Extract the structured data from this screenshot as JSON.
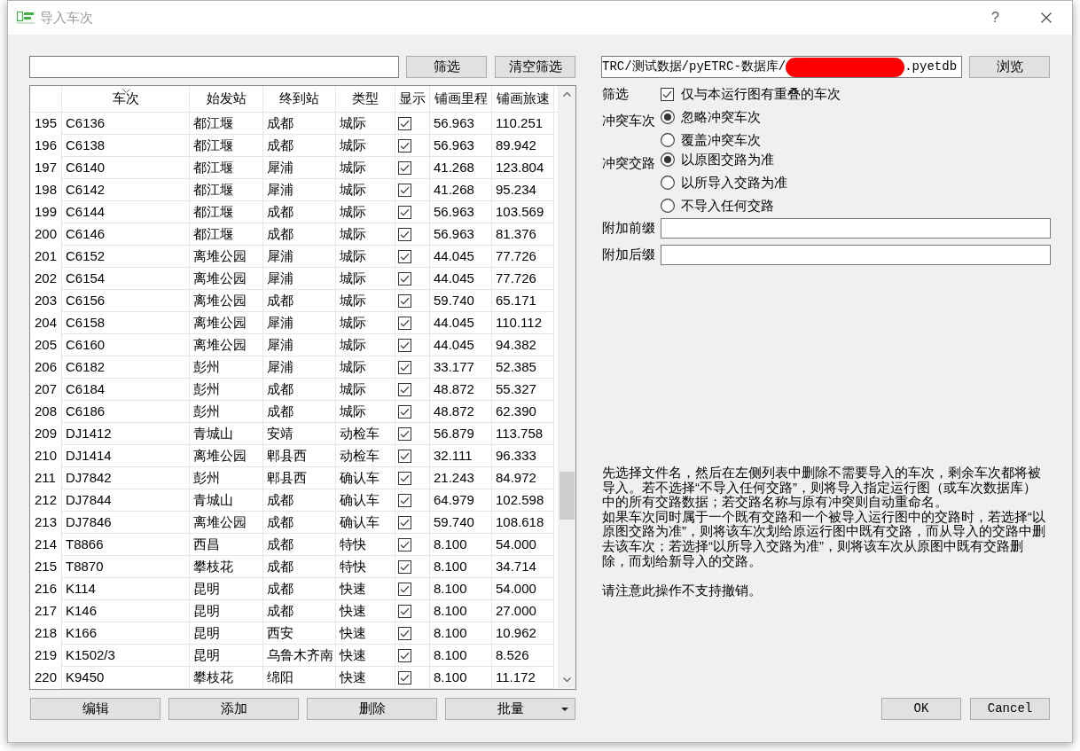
{
  "window": {
    "title": "导入车次",
    "help": "?"
  },
  "filter_bar": {
    "buttons": [
      "筛选",
      "清空筛选"
    ]
  },
  "table": {
    "columns": [
      {
        "label": "车次",
        "kind": "text",
        "sorted": true
      },
      {
        "label": "始发站",
        "kind": "text",
        "sorted": false
      },
      {
        "label": "终到站",
        "kind": "text",
        "sorted": false
      },
      {
        "label": "类型",
        "kind": "text",
        "sorted": false
      },
      {
        "label": "显示",
        "kind": "check",
        "sorted": false
      },
      {
        "label": "铺画里程",
        "kind": "text",
        "sorted": false
      },
      {
        "label": "铺画旅速",
        "kind": "text",
        "sorted": false
      }
    ],
    "rows": [
      {
        "index": "195",
        "train": "C6136",
        "origin": "都江堰",
        "terminal": "成都",
        "type": "城际",
        "shown": true,
        "mileage": "56.963",
        "speed": "110.251"
      },
      {
        "index": "196",
        "train": "C6138",
        "origin": "都江堰",
        "terminal": "成都",
        "type": "城际",
        "shown": true,
        "mileage": "56.963",
        "speed": "89.942"
      },
      {
        "index": "197",
        "train": "C6140",
        "origin": "都江堰",
        "terminal": "犀浦",
        "type": "城际",
        "shown": true,
        "mileage": "41.268",
        "speed": "123.804"
      },
      {
        "index": "198",
        "train": "C6142",
        "origin": "都江堰",
        "terminal": "犀浦",
        "type": "城际",
        "shown": true,
        "mileage": "41.268",
        "speed": "95.234"
      },
      {
        "index": "199",
        "train": "C6144",
        "origin": "都江堰",
        "terminal": "成都",
        "type": "城际",
        "shown": true,
        "mileage": "56.963",
        "speed": "103.569"
      },
      {
        "index": "200",
        "train": "C6146",
        "origin": "都江堰",
        "terminal": "成都",
        "type": "城际",
        "shown": true,
        "mileage": "56.963",
        "speed": "81.376"
      },
      {
        "index": "201",
        "train": "C6152",
        "origin": "离堆公园",
        "terminal": "犀浦",
        "type": "城际",
        "shown": true,
        "mileage": "44.045",
        "speed": "77.726"
      },
      {
        "index": "202",
        "train": "C6154",
        "origin": "离堆公园",
        "terminal": "犀浦",
        "type": "城际",
        "shown": true,
        "mileage": "44.045",
        "speed": "77.726"
      },
      {
        "index": "203",
        "train": "C6156",
        "origin": "离堆公园",
        "terminal": "成都",
        "type": "城际",
        "shown": true,
        "mileage": "59.740",
        "speed": "65.171"
      },
      {
        "index": "204",
        "train": "C6158",
        "origin": "离堆公园",
        "terminal": "犀浦",
        "type": "城际",
        "shown": true,
        "mileage": "44.045",
        "speed": "110.112"
      },
      {
        "index": "205",
        "train": "C6160",
        "origin": "离堆公园",
        "terminal": "犀浦",
        "type": "城际",
        "shown": true,
        "mileage": "44.045",
        "speed": "94.382"
      },
      {
        "index": "206",
        "train": "C6182",
        "origin": "彭州",
        "terminal": "犀浦",
        "type": "城际",
        "shown": true,
        "mileage": "33.177",
        "speed": "52.385"
      },
      {
        "index": "207",
        "train": "C6184",
        "origin": "彭州",
        "terminal": "成都",
        "type": "城际",
        "shown": true,
        "mileage": "48.872",
        "speed": "55.327"
      },
      {
        "index": "208",
        "train": "C6186",
        "origin": "彭州",
        "terminal": "成都",
        "type": "城际",
        "shown": true,
        "mileage": "48.872",
        "speed": "62.390"
      },
      {
        "index": "209",
        "train": "DJ1412",
        "origin": "青城山",
        "terminal": "安靖",
        "type": "动检车",
        "shown": true,
        "mileage": "56.879",
        "speed": "113.758"
      },
      {
        "index": "210",
        "train": "DJ1414",
        "origin": "离堆公园",
        "terminal": "郫县西",
        "type": "动检车",
        "shown": true,
        "mileage": "32.111",
        "speed": "96.333"
      },
      {
        "index": "211",
        "train": "DJ7842",
        "origin": "彭州",
        "terminal": "郫县西",
        "type": "确认车",
        "shown": true,
        "mileage": "21.243",
        "speed": "84.972"
      },
      {
        "index": "212",
        "train": "DJ7844",
        "origin": "青城山",
        "terminal": "成都",
        "type": "确认车",
        "shown": true,
        "mileage": "64.979",
        "speed": "102.598"
      },
      {
        "index": "213",
        "train": "DJ7846",
        "origin": "离堆公园",
        "terminal": "成都",
        "type": "确认车",
        "shown": true,
        "mileage": "59.740",
        "speed": "108.618"
      },
      {
        "index": "214",
        "train": "T8866",
        "origin": "西昌",
        "terminal": "成都",
        "type": "特快",
        "shown": true,
        "mileage": "8.100",
        "speed": "54.000"
      },
      {
        "index": "215",
        "train": "T8870",
        "origin": "攀枝花",
        "terminal": "成都",
        "type": "特快",
        "shown": true,
        "mileage": "8.100",
        "speed": "34.714"
      },
      {
        "index": "216",
        "train": "K114",
        "origin": "昆明",
        "terminal": "成都",
        "type": "快速",
        "shown": true,
        "mileage": "8.100",
        "speed": "54.000"
      },
      {
        "index": "217",
        "train": "K146",
        "origin": "昆明",
        "terminal": "成都",
        "type": "快速",
        "shown": true,
        "mileage": "8.100",
        "speed": "27.000"
      },
      {
        "index": "218",
        "train": "K166",
        "origin": "昆明",
        "terminal": "西安",
        "type": "快速",
        "shown": true,
        "mileage": "8.100",
        "speed": "10.962"
      },
      {
        "index": "219",
        "train": "K1502/3",
        "origin": "昆明",
        "terminal": "乌鲁木齐南",
        "type": "快速",
        "shown": true,
        "mileage": "8.100",
        "speed": "8.526"
      },
      {
        "index": "220",
        "train": "K9450",
        "origin": "攀枝花",
        "terminal": "绵阳",
        "type": "快速",
        "shown": true,
        "mileage": "8.100",
        "speed": "11.172"
      }
    ]
  },
  "list_buttons": [
    {
      "label": "编辑",
      "kind": "plain"
    },
    {
      "label": "添加",
      "kind": "plain"
    },
    {
      "label": "删除",
      "kind": "plain"
    },
    {
      "label": "批量",
      "kind": "dropdown"
    }
  ],
  "file": {
    "path": "TRC/测试数据/pyETRC-数据库/",
    "extension": ".pyetdb",
    "button": "浏览"
  },
  "options": {
    "filter": {
      "label": "筛选",
      "checkbox": {
        "label": "仅与本运行图有重叠的车次",
        "checked": true
      }
    },
    "conflict_train": {
      "label": "冲突车次",
      "choices": [
        {
          "label": "忽略冲突车次",
          "selected": true
        },
        {
          "label": "覆盖冲突车次",
          "selected": false
        }
      ]
    },
    "conflict_route": {
      "label": "冲突交路",
      "choices": [
        {
          "label": "以原图交路为准",
          "selected": true
        },
        {
          "label": "以所导入交路为准",
          "selected": false
        },
        {
          "label": "不导入任何交路",
          "selected": false
        }
      ]
    },
    "prefix": {
      "label": "附加前缀"
    },
    "suffix": {
      "label": "附加后缀"
    }
  },
  "description": [
    "先选择文件名，然后在左侧列表中删除不需要导入的车次，剩余车次都将被导入。若不选择“不导入任何交路”，则将导入指定运行图（或车次数据库）中的所有交路数据；若交路名称与原有冲突则自动重命名。",
    "如果车次同时属于一个既有交路和一个被导入运行图中的交路时，若选择“以原图交路为准”，则将该车次划给原运行图中既有交路，而从导入的交路中删去该车次；若选择“以所导入交路为准”，则将该车次从原图中既有交路删除，而划给新导入的交路。",
    "请注意此操作不支持撤销。"
  ],
  "dialog_buttons": [
    "OK",
    "Cancel"
  ]
}
